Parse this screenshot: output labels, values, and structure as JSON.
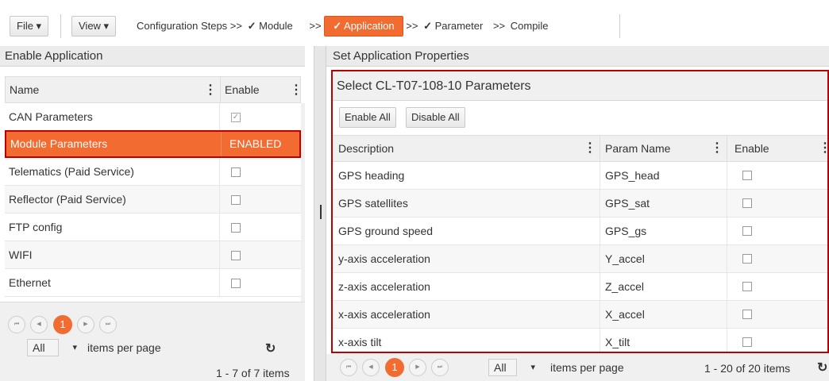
{
  "toolbar": {
    "file_label": "File ▾",
    "view_label": "View ▾",
    "steps_prefix": "Configuration Steps >>",
    "steps": [
      {
        "label": "Module",
        "check": "✓",
        "sep": ""
      },
      {
        "label": "Application",
        "check": "✓",
        "sep": ">>"
      },
      {
        "label": "Parameter",
        "check": "✓",
        "sep": ">>"
      },
      {
        "label": "Compile",
        "check": "",
        "sep": ">>"
      }
    ]
  },
  "left": {
    "title": "Enable Application",
    "col_name": "Name",
    "col_enable": "Enable",
    "rows": [
      {
        "name": "CAN Parameters",
        "checked": true
      },
      {
        "name": "Module Parameters",
        "enabled_text": "ENABLED"
      },
      {
        "name": "Telematics (Paid Service)",
        "checked": false
      },
      {
        "name": "Reflector (Paid Service)",
        "checked": false
      },
      {
        "name": "FTP config",
        "checked": false
      },
      {
        "name": "WIFI",
        "checked": false
      },
      {
        "name": "Ethernet",
        "checked": false
      }
    ],
    "pager": {
      "first": "⏮",
      "prev": "◀",
      "current": "1",
      "next": "▶",
      "last": "⏭",
      "page_size": "All",
      "items_per_page": "items per page",
      "range": "1 - 7 of 7 items"
    }
  },
  "right": {
    "title": "Set Application Properties",
    "subtitle": "Select CL-T07-108-10 Parameters",
    "enable_all": "Enable All",
    "disable_all": "Disable All",
    "col_desc": "Description",
    "col_param": "Param Name",
    "col_enable": "Enable",
    "rows": [
      {
        "desc": "GPS heading",
        "param": "GPS_head"
      },
      {
        "desc": "GPS satellites",
        "param": "GPS_sat"
      },
      {
        "desc": "GPS ground speed",
        "param": "GPS_gs"
      },
      {
        "desc": "y-axis acceleration",
        "param": "Y_accel"
      },
      {
        "desc": "z-axis acceleration",
        "param": "Z_accel"
      },
      {
        "desc": "x-axis acceleration",
        "param": "X_accel"
      },
      {
        "desc": "x-axis tilt",
        "param": "X_tilt"
      }
    ],
    "pager": {
      "current": "1",
      "page_size": "All",
      "items_per_page": "items per page",
      "range": "1 - 20 of 20 items"
    }
  },
  "icons": {
    "menu": "⋮",
    "refresh": "↻",
    "dropdown": "▾",
    "check": "✓"
  }
}
